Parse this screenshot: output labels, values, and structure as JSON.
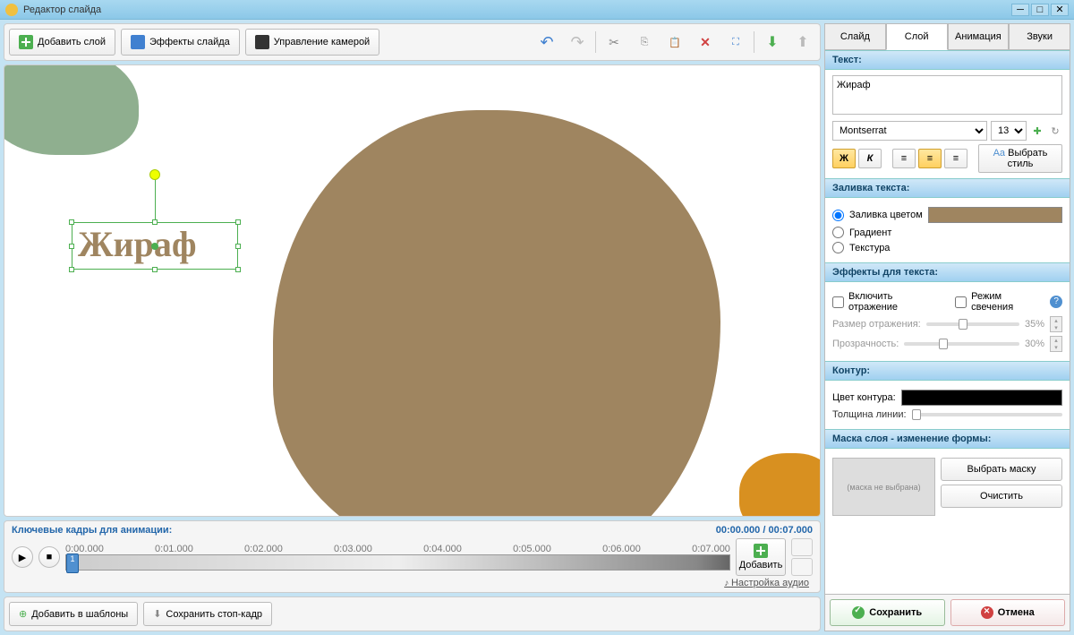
{
  "window": {
    "title": "Редактор слайда"
  },
  "toolbar": {
    "add_layer": "Добавить слой",
    "slide_effects": "Эффекты слайда",
    "camera": "Управление камерой"
  },
  "canvas": {
    "selected_text": "Жираф"
  },
  "timeline": {
    "title": "Ключевые кадры для анимации:",
    "current": "00:00.000",
    "total": "00:07.000",
    "ticks": [
      "0:00.000",
      "0:01.000",
      "0:02.000",
      "0:03.000",
      "0:04.000",
      "0:05.000",
      "0:06.000",
      "0:07.000"
    ],
    "marker": "1",
    "add": "Добавить",
    "audio": "Настройка аудио"
  },
  "bottom": {
    "add_template": "Добавить в шаблоны",
    "save_still": "Сохранить стоп-кадр"
  },
  "tabs": {
    "slide": "Слайд",
    "layer": "Слой",
    "animation": "Анимация",
    "sounds": "Звуки"
  },
  "text_section": {
    "header": "Текст:",
    "value": "Жираф",
    "font": "Montserrat",
    "size": "13",
    "bold": "Ж",
    "italic": "К",
    "pick_style": "Выбрать стиль",
    "aa": "Aa"
  },
  "fill_section": {
    "header": "Заливка текста:",
    "color_fill": "Заливка цветом",
    "gradient": "Градиент",
    "texture": "Текстура",
    "color": "#9f8560"
  },
  "effects_section": {
    "header": "Эффекты для текста:",
    "reflection": "Включить отражение",
    "glow": "Режим свечения",
    "refl_size": "Размер отражения:",
    "refl_size_val": "35%",
    "transparency": "Прозрачность:",
    "transparency_val": "30%"
  },
  "contour_section": {
    "header": "Контур:",
    "color_label": "Цвет контура:",
    "thickness_label": "Толщина линии:"
  },
  "mask_section": {
    "header": "Маска слоя - изменение формы:",
    "none": "(маска не выбрана)",
    "pick": "Выбрать маску",
    "clear": "Очистить"
  },
  "actions": {
    "save": "Сохранить",
    "cancel": "Отмена"
  }
}
